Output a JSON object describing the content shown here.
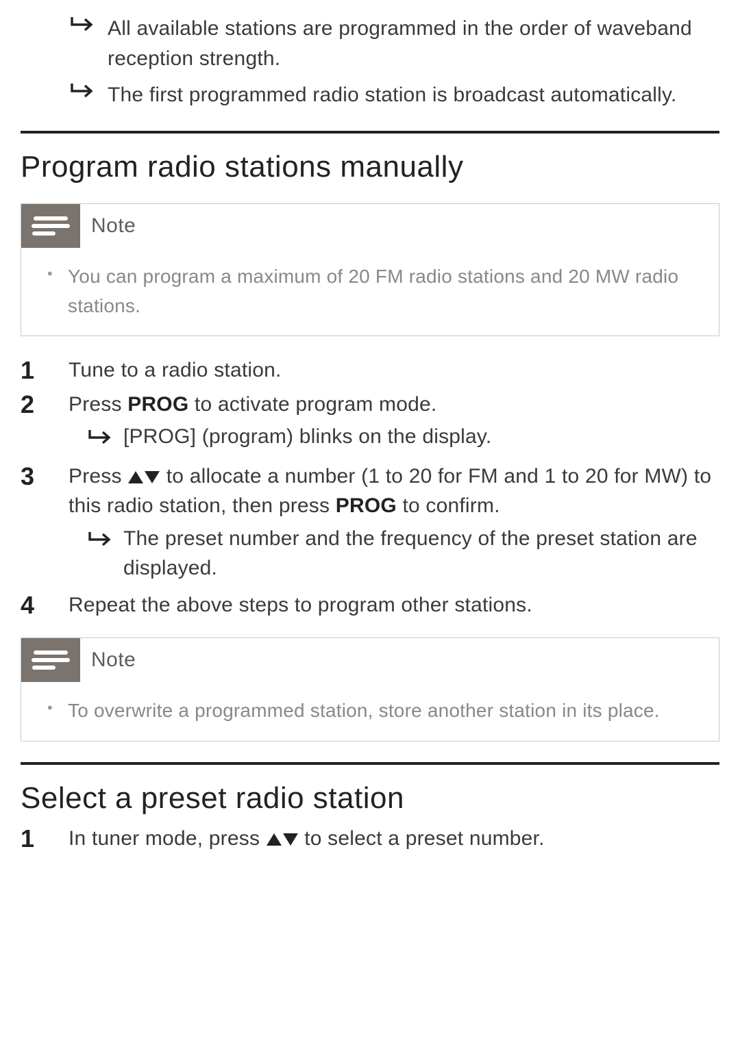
{
  "intro_results": [
    "All available stations are programmed in the order of waveband reception strength.",
    "The first programmed radio station is broadcast automatically."
  ],
  "section1": {
    "heading": "Program radio stations manually",
    "note_label": "Note",
    "note_text": "You can program a maximum of 20 FM radio stations and 20 MW radio stations.",
    "steps": {
      "s1": "Tune to a radio station.",
      "s2_a": "Press ",
      "s2_b": "PROG",
      "s2_c": " to activate program mode.",
      "s2_result": "[PROG] (program) blinks on the display.",
      "s3_a": "Press ",
      "s3_b": " to allocate a number (1 to 20 for FM and 1 to 20 for MW) to this radio station, then press ",
      "s3_c": "PROG",
      "s3_d": " to confirm.",
      "s3_result": "The preset number and the frequency of the preset station are displayed.",
      "s4": "Repeat the above steps to program other stations."
    },
    "note2_label": "Note",
    "note2_text": "To overwrite a programmed station, store another station in its place."
  },
  "section2": {
    "heading": "Select a preset radio station",
    "step1_a": "In tuner mode, press ",
    "step1_b": " to select a preset number."
  }
}
